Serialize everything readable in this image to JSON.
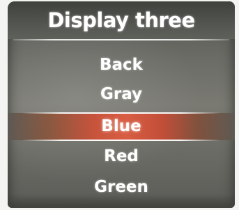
{
  "display": {
    "title": "Display three",
    "menu_items": [
      "Back",
      "Gray",
      "Blue",
      "Red",
      "Green"
    ],
    "selected_item": "Blue"
  },
  "colors": {
    "title_bar": "#4b4d48",
    "screen_background": "#6f706a",
    "selected_highlight": "#d85d43",
    "text": "#ffffff",
    "divider": "#eeeeee"
  }
}
